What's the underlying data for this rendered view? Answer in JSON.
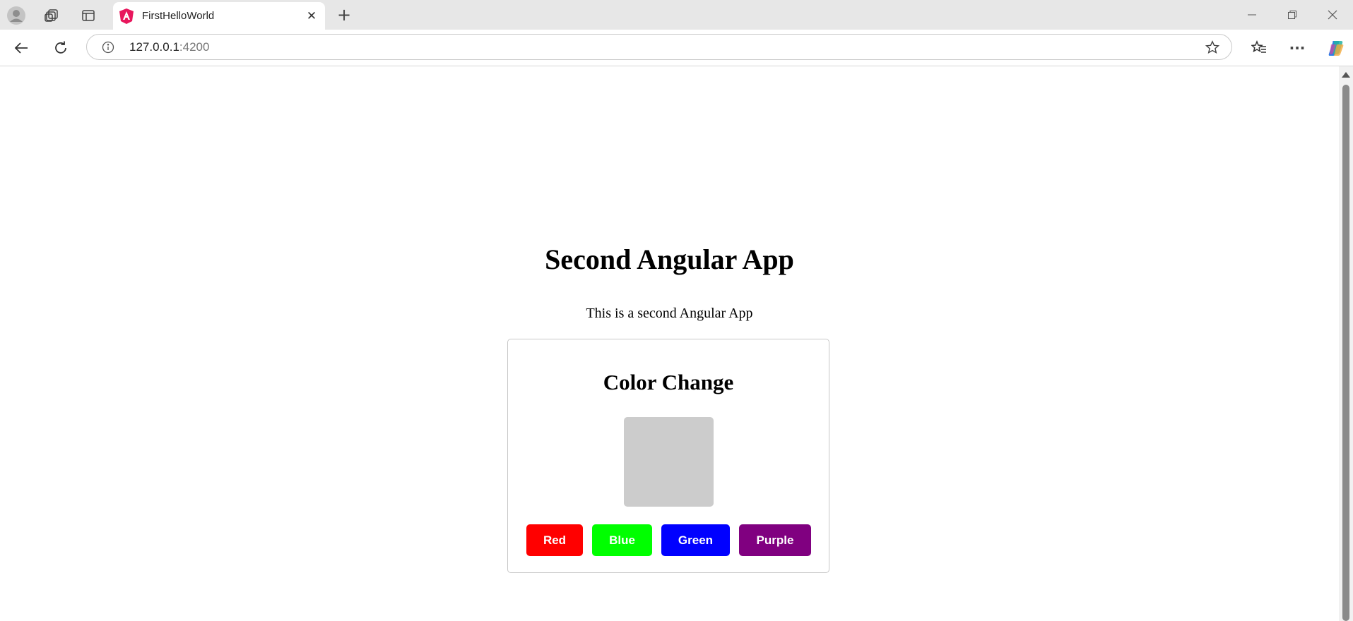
{
  "browser": {
    "tab": {
      "title": "FirstHelloWorld"
    },
    "address_bar": {
      "host": "127.0.0.1",
      "port": ":4200"
    }
  },
  "page": {
    "title": "Second Angular App",
    "subtitle": "This is a second Angular App",
    "card": {
      "title": "Color Change",
      "preview_color": "#cccccc",
      "buttons": [
        {
          "label": "Red",
          "color": "#ff0000"
        },
        {
          "label": "Blue",
          "color": "#00ff00"
        },
        {
          "label": "Green",
          "color": "#0000ff"
        },
        {
          "label": "Purple",
          "color": "#800080"
        }
      ]
    }
  }
}
